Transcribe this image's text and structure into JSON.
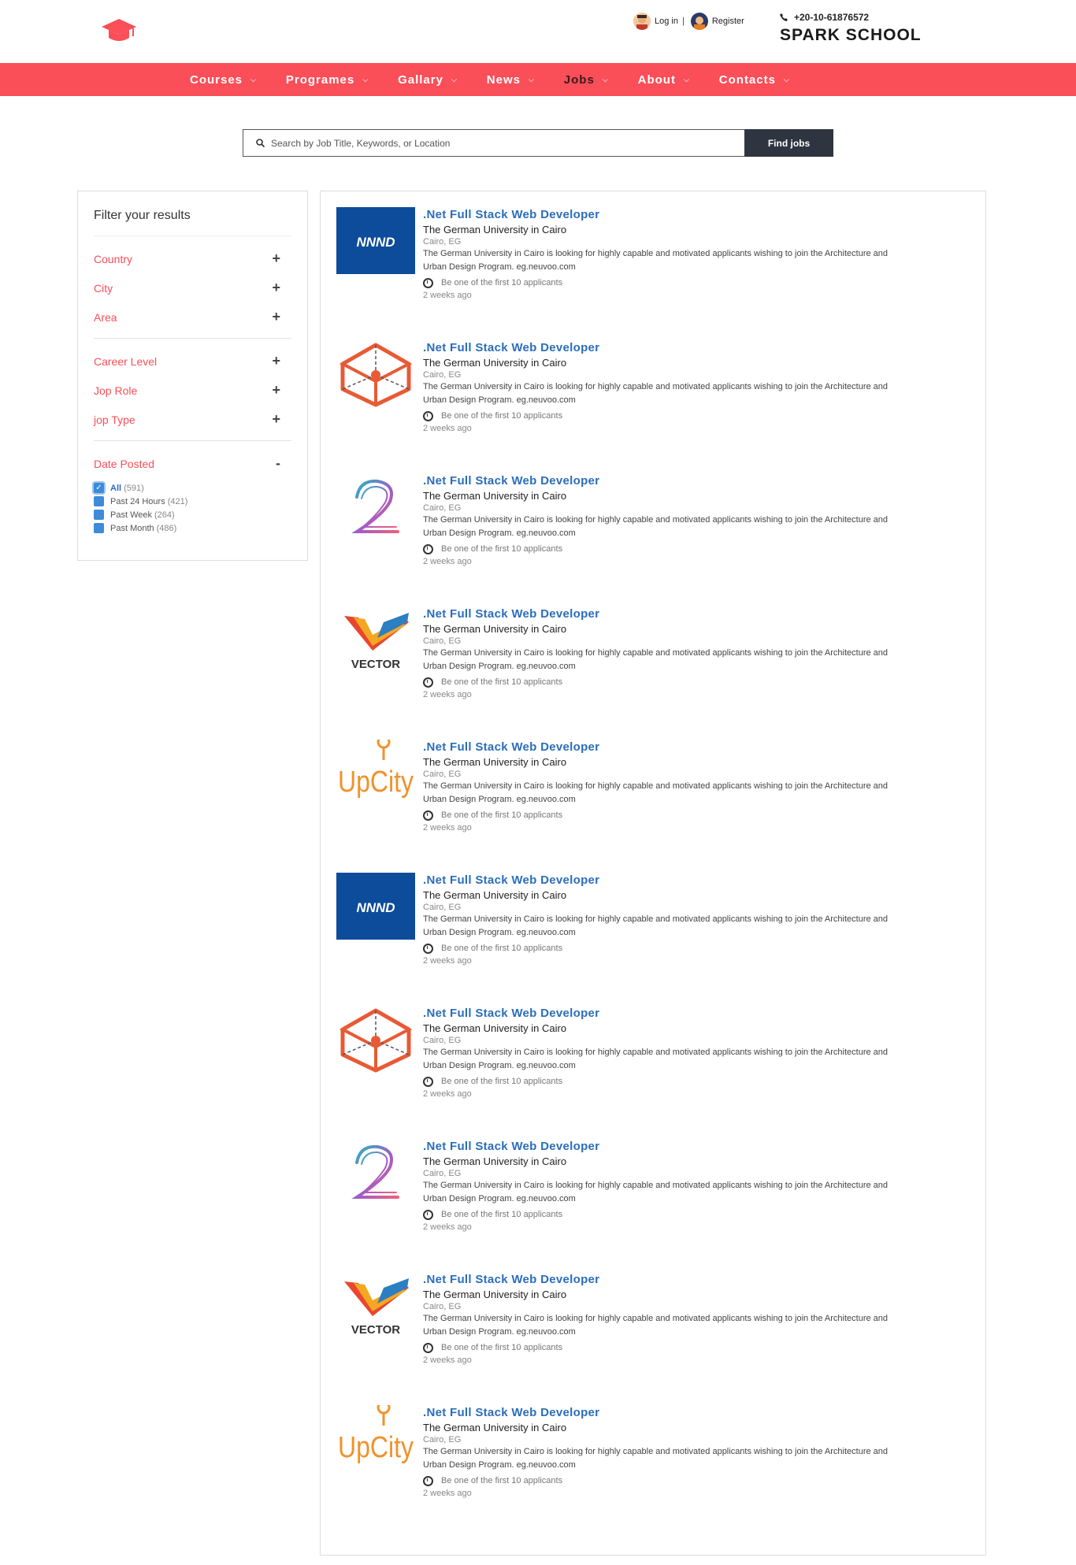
{
  "header": {
    "login_label": "Log in",
    "separator": "|",
    "register_label": "Register",
    "phone": "+20-10-61876572",
    "brand": "SPARK SCHOOL"
  },
  "nav": [
    {
      "label": "Courses"
    },
    {
      "label": "Programes"
    },
    {
      "label": "Gallary"
    },
    {
      "label": "News"
    },
    {
      "label": "Jobs"
    },
    {
      "label": "About"
    },
    {
      "label": "Contacts"
    }
  ],
  "colors": {
    "accent": "#fa4e58",
    "link": "#2a6dbc",
    "button_dark": "#2f3540"
  },
  "search": {
    "placeholder": "Search by Job Title, Keywords, or Location",
    "button": "Find jobs"
  },
  "filters": {
    "title": "Filter your results",
    "groups": [
      [
        {
          "label": "Country",
          "sign": "+"
        },
        {
          "label": "City",
          "sign": "+"
        },
        {
          "label": "Area",
          "sign": "+"
        }
      ],
      [
        {
          "label": "Career Level",
          "sign": "+"
        },
        {
          "label": "Jop Role",
          "sign": "+"
        },
        {
          "label": "jop Type",
          "sign": "+"
        }
      ]
    ],
    "date_posted": {
      "label": "Date Posted",
      "sign": "-",
      "options": [
        {
          "label": "All",
          "count": "(591)",
          "checked": true
        },
        {
          "label": "Past 24 Hours",
          "count": "(421)",
          "checked": false
        },
        {
          "label": "Past Week",
          "count": "(264)",
          "checked": false
        },
        {
          "label": "Past Month",
          "count": "(486)",
          "checked": false
        }
      ]
    }
  },
  "jobs": [
    {
      "logo": "nnnd-logo",
      "title": ".Net Full Stack Web Developer",
      "company": "The German University in Cairo",
      "location": "Cairo, EG",
      "desc1": "The German University in Cairo is looking for highly capable and motivated applicants wishing to join the Architecture and",
      "desc2": "Urban Design Program. eg.neuvoo.com",
      "applicants": "Be one of the first 10 applicants",
      "posted": "2 weeks ago"
    },
    {
      "logo": "cube-logo",
      "title": ".Net Full Stack Web Developer",
      "company": "The German University in Cairo",
      "location": "Cairo, EG",
      "desc1": "The German University in Cairo is looking for highly capable and motivated applicants wishing to join the Architecture and",
      "desc2": "Urban Design Program. eg.neuvoo.com",
      "applicants": "Be one of the first 10 applicants",
      "posted": "2 weeks ago"
    },
    {
      "logo": "two-logo",
      "title": ".Net Full Stack Web Developer",
      "company": "The German University in Cairo",
      "location": "Cairo, EG",
      "desc1": "The German University in Cairo is looking for highly capable and motivated applicants wishing to join the Architecture and",
      "desc2": "Urban Design Program. eg.neuvoo.com",
      "applicants": "Be one of the first 10 applicants",
      "posted": "2 weeks ago"
    },
    {
      "logo": "vector-logo",
      "logo_text": "VECTOR",
      "title": ".Net Full Stack Web Developer",
      "company": "The German University in Cairo",
      "location": "Cairo, EG",
      "desc1": "The German University in Cairo is looking for highly capable and motivated applicants wishing to join the Architecture and",
      "desc2": "Urban Design Program. eg.neuvoo.com",
      "applicants": "Be one of the first 10 applicants",
      "posted": "2 weeks ago"
    },
    {
      "logo": "upcity-logo",
      "logo_text": "UpCity",
      "title": ".Net Full Stack Web Developer",
      "company": "The German University in Cairo",
      "location": "Cairo, EG",
      "desc1": "The German University in Cairo is looking for highly capable and motivated applicants wishing to join the Architecture and",
      "desc2": "Urban Design Program. eg.neuvoo.com",
      "applicants": "Be one of the first 10 applicants",
      "posted": "2 weeks ago"
    },
    {
      "logo": "nnnd-logo",
      "title": ".Net Full Stack Web Developer",
      "company": "The German University in Cairo",
      "location": "Cairo, EG",
      "desc1": "The German University in Cairo is looking for highly capable and motivated applicants wishing to join the Architecture and",
      "desc2": "Urban Design Program. eg.neuvoo.com",
      "applicants": "Be one of the first 10 applicants",
      "posted": "2 weeks ago"
    },
    {
      "logo": "cube-logo",
      "title": ".Net Full Stack Web Developer",
      "company": "The German University in Cairo",
      "location": "Cairo, EG",
      "desc1": "The German University in Cairo is looking for highly capable and motivated applicants wishing to join the Architecture and",
      "desc2": "Urban Design Program. eg.neuvoo.com",
      "applicants": "Be one of the first 10 applicants",
      "posted": "2 weeks ago"
    },
    {
      "logo": "two-logo",
      "title": ".Net Full Stack Web Developer",
      "company": "The German University in Cairo",
      "location": "Cairo, EG",
      "desc1": "The German University in Cairo is looking for highly capable and motivated applicants wishing to join the Architecture and",
      "desc2": "Urban Design Program. eg.neuvoo.com",
      "applicants": "Be one of the first 10 applicants",
      "posted": "2 weeks ago"
    },
    {
      "logo": "vector-logo",
      "logo_text": "VECTOR",
      "title": ".Net Full Stack Web Developer",
      "company": "The German University in Cairo",
      "location": "Cairo, EG",
      "desc1": "The German University in Cairo is looking for highly capable and motivated applicants wishing to join the Architecture and",
      "desc2": "Urban Design Program. eg.neuvoo.com",
      "applicants": "Be one of the first 10 applicants",
      "posted": "2 weeks ago"
    },
    {
      "logo": "upcity-logo",
      "logo_text": "UpCity",
      "title": ".Net Full Stack Web Developer",
      "company": "The German University in Cairo",
      "location": "Cairo, EG",
      "desc1": "The German University in Cairo is looking for highly capable and motivated applicants wishing to join the Architecture and",
      "desc2": "Urban Design Program. eg.neuvoo.com",
      "applicants": "Be one of the first 10 applicants",
      "posted": "2 weeks ago"
    }
  ]
}
